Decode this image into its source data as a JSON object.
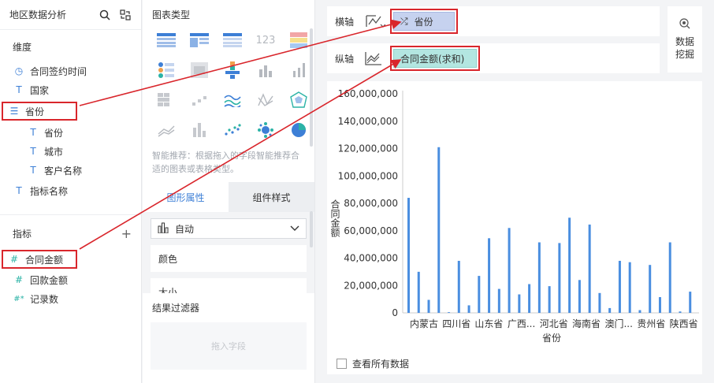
{
  "left": {
    "title": "地区数据分析",
    "dimension_title": "维度",
    "dimensions": [
      {
        "label": "合同签约时间",
        "icon": "clock-icon",
        "glyph": "◷"
      },
      {
        "label": "国家",
        "icon": "text-type-icon",
        "glyph": "T"
      },
      {
        "label": "省份",
        "icon": "hierarchy-icon",
        "glyph": "☰"
      },
      {
        "label": "省份",
        "icon": "text-type-icon",
        "glyph": "T"
      },
      {
        "label": "城市",
        "icon": "text-type-icon",
        "glyph": "T"
      },
      {
        "label": "客户名称",
        "icon": "text-type-icon",
        "glyph": "T"
      },
      {
        "label": "指标名称",
        "icon": "text-type-icon",
        "glyph": "T"
      }
    ],
    "metric_title": "指标",
    "add_glyph": "+",
    "metrics": [
      {
        "label": "合同金额",
        "icon": "number-icon",
        "glyph": "#"
      },
      {
        "label": "回款金额",
        "icon": "number-icon",
        "glyph": "#"
      },
      {
        "label": "记录数",
        "icon": "number-icon",
        "glyph": "#*"
      }
    ]
  },
  "mid": {
    "title": "图表类型",
    "hint": "智能推荐：根据拖入的字段智能推荐合适的图表或表格类型。",
    "tabs": [
      "图形属性",
      "组件样式"
    ],
    "select_value": "自动",
    "props": [
      "颜色",
      "大小"
    ],
    "filter_title": "结果过滤器",
    "drop_placeholder": "拖入字段"
  },
  "right": {
    "x_axis_label": "横轴",
    "y_axis_label": "纵轴",
    "x_field": "省份",
    "y_field": "合同金额(求和)",
    "mining_label_1": "数据",
    "mining_label_2": "挖掘",
    "check_label": "查看所有数据"
  },
  "colors": {
    "accent": "#3d7fd6",
    "bar": "#4a8ee0",
    "highlight": "#d9262c"
  },
  "chart_data": {
    "type": "bar",
    "xlabel": "省份",
    "ylabel": "合同金额",
    "ylim": [
      0,
      160000000
    ],
    "yticks": [
      "0",
      "20,000,000",
      "40,000,000",
      "60,000,000",
      "80,000,000",
      "100,000,000",
      "120,000,000",
      "140,000,000",
      "160,000,000"
    ],
    "tick_labels": [
      "内蒙古",
      "四川省",
      "山东省",
      "广西...",
      "河北省",
      "海南省",
      "澳门...",
      "贵州省",
      "陕西省"
    ],
    "values": [
      84000000,
      30000000,
      9500000,
      121000000,
      500000,
      38000000,
      5500000,
      27000000,
      54500000,
      17500000,
      62000000,
      13500000,
      21000000,
      51500000,
      19500000,
      51000000,
      69500000,
      24000000,
      64500000,
      14500000,
      3500000,
      38000000,
      37000000,
      2000000,
      35000000,
      11500000,
      51500000,
      1000000,
      15500000
    ]
  }
}
